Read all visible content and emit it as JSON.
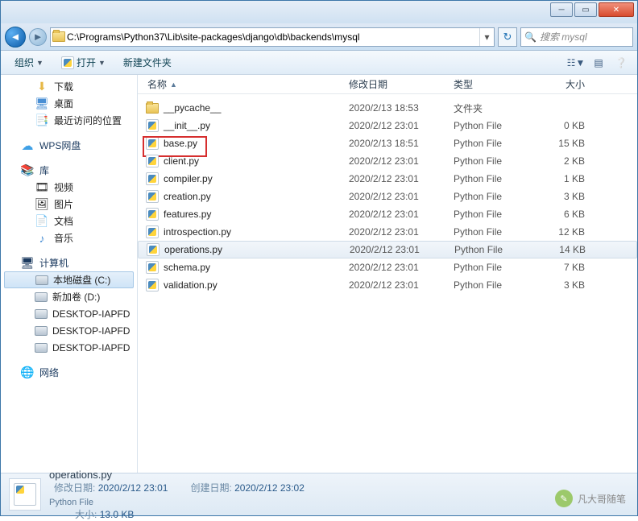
{
  "address": "C:\\Programs\\Python37\\Lib\\site-packages\\django\\db\\backends\\mysql",
  "search_placeholder": "搜索 mysql",
  "toolbar": {
    "organize": "组织",
    "open": "打开",
    "new_folder": "新建文件夹"
  },
  "columns": {
    "name": "名称",
    "date": "修改日期",
    "type": "类型",
    "size": "大小"
  },
  "sidebar": {
    "downloads": "下载",
    "desktop": "桌面",
    "recent": "最近访问的位置",
    "wps": "WPS网盘",
    "libraries": "库",
    "videos": "视频",
    "pictures": "图片",
    "documents": "文档",
    "music": "音乐",
    "computer": "计算机",
    "drive_c": "本地磁盘 (C:)",
    "drive_d": "新加卷 (D:)",
    "net1": "DESKTOP-IAPFD",
    "net2": "DESKTOP-IAPFD",
    "net3": "DESKTOP-IAPFD",
    "network": "网络"
  },
  "files": [
    {
      "name": "__pycache__",
      "date": "2020/2/13 18:53",
      "type": "文件夹",
      "size": "",
      "icon": "folder"
    },
    {
      "name": "__init__.py",
      "date": "2020/2/12 23:01",
      "type": "Python File",
      "size": "0 KB",
      "icon": "py"
    },
    {
      "name": "base.py",
      "date": "2020/2/13 18:51",
      "type": "Python File",
      "size": "15 KB",
      "icon": "py",
      "highlight": true
    },
    {
      "name": "client.py",
      "date": "2020/2/12 23:01",
      "type": "Python File",
      "size": "2 KB",
      "icon": "py"
    },
    {
      "name": "compiler.py",
      "date": "2020/2/12 23:01",
      "type": "Python File",
      "size": "1 KB",
      "icon": "py"
    },
    {
      "name": "creation.py",
      "date": "2020/2/12 23:01",
      "type": "Python File",
      "size": "3 KB",
      "icon": "py"
    },
    {
      "name": "features.py",
      "date": "2020/2/12 23:01",
      "type": "Python File",
      "size": "6 KB",
      "icon": "py"
    },
    {
      "name": "introspection.py",
      "date": "2020/2/12 23:01",
      "type": "Python File",
      "size": "12 KB",
      "icon": "py"
    },
    {
      "name": "operations.py",
      "date": "2020/2/12 23:01",
      "type": "Python File",
      "size": "14 KB",
      "icon": "py",
      "selected": true
    },
    {
      "name": "schema.py",
      "date": "2020/2/12 23:01",
      "type": "Python File",
      "size": "7 KB",
      "icon": "py"
    },
    {
      "name": "validation.py",
      "date": "2020/2/12 23:01",
      "type": "Python File",
      "size": "3 KB",
      "icon": "py"
    }
  ],
  "status": {
    "filename": "operations.py",
    "filetype": "Python File",
    "mod_label": "修改日期:",
    "mod_value": "2020/2/12 23:01",
    "create_label": "创建日期:",
    "create_value": "2020/2/12 23:02",
    "size_label": "大小:",
    "size_value": "13.0 KB"
  },
  "watermark": "凡大哥随笔"
}
